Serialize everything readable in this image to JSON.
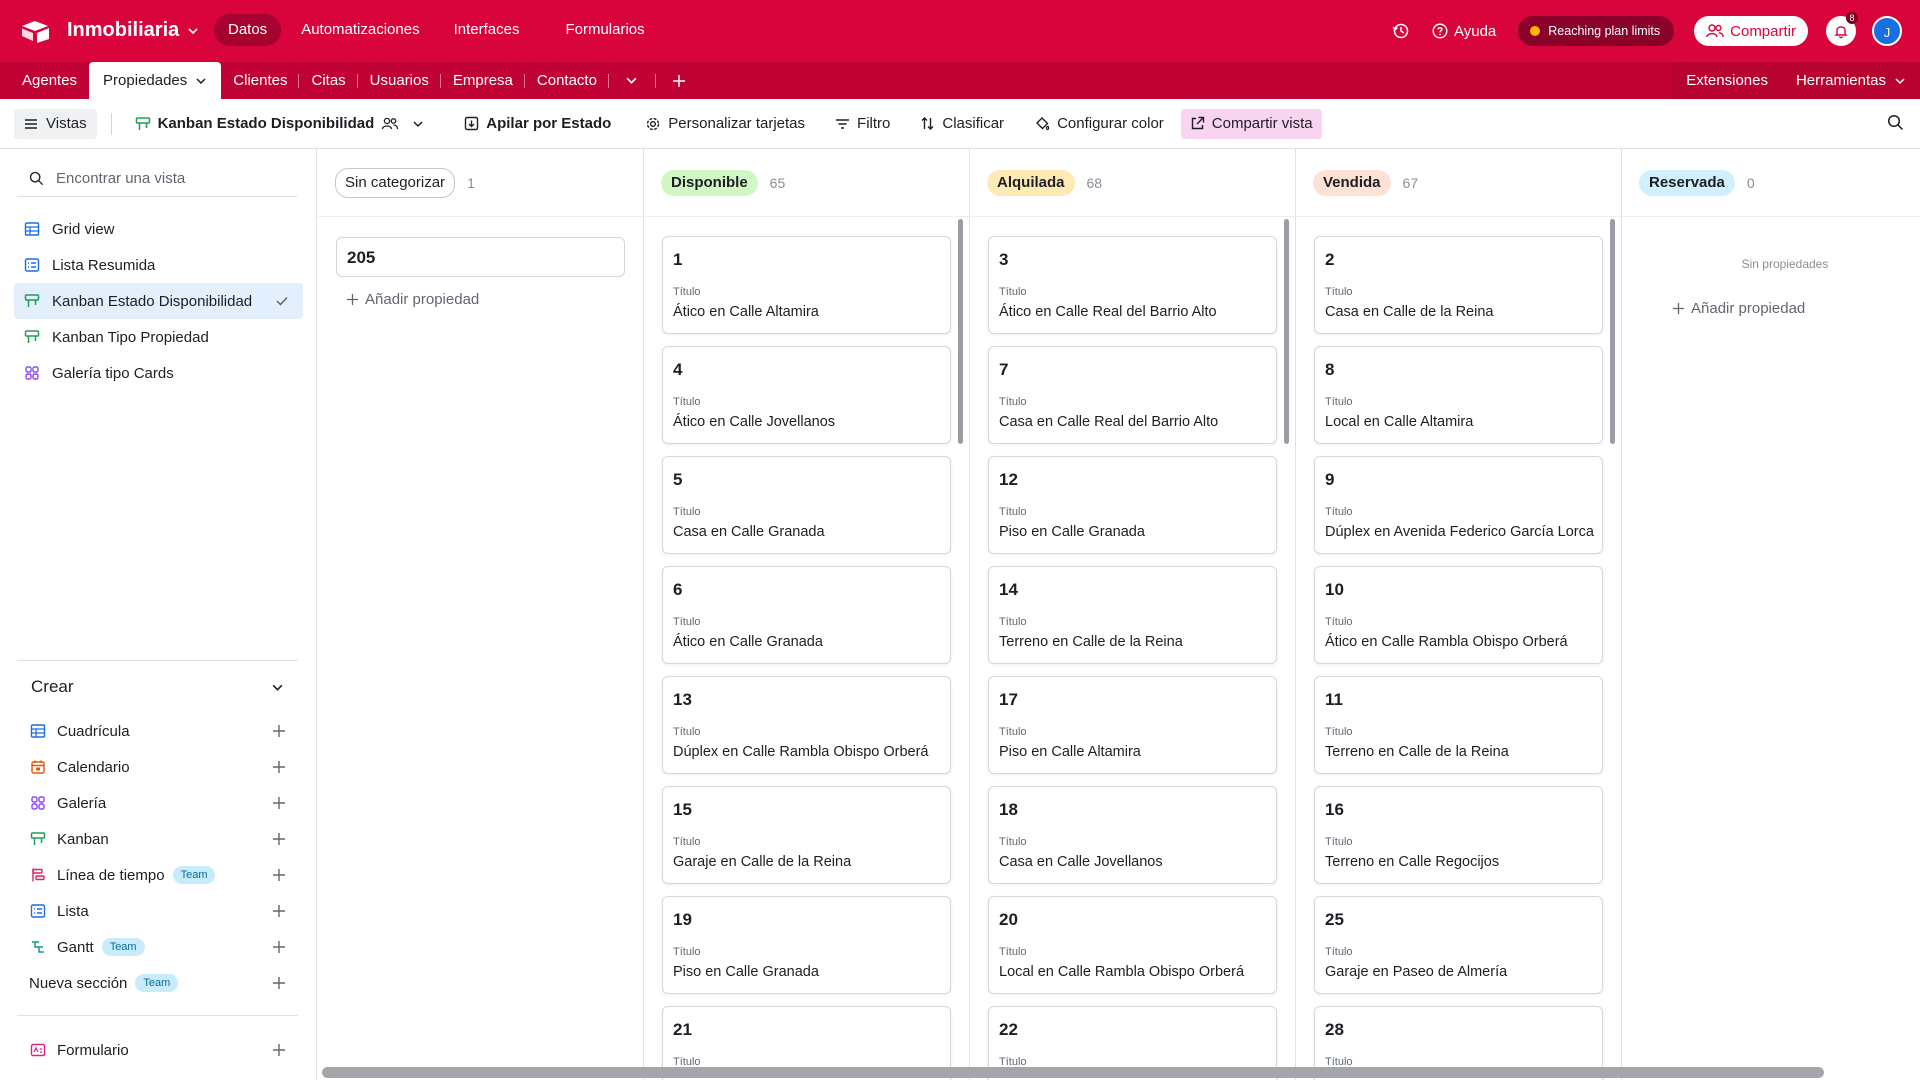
{
  "app": {
    "base_name": "Inmobiliaria"
  },
  "topnav": [
    "Datos",
    "Automatizaciones",
    "Interfaces",
    "Formularios"
  ],
  "topright": {
    "help": "Ayuda",
    "plan": "Reaching plan limits",
    "share": "Compartir",
    "notifications": "8",
    "avatar": "J"
  },
  "tables": [
    "Agentes",
    "Propiedades",
    "Clientes",
    "Citas",
    "Usuarios",
    "Empresa",
    "Contacto"
  ],
  "tables_right": [
    "Extensiones",
    "Herramientas"
  ],
  "viewbar": {
    "views": "Vistas",
    "current_view": "Kanban Estado Disponibilidad",
    "stack": "Apilar por Estado",
    "customize": "Personalizar tarjetas",
    "filter": "Filtro",
    "sort": "Clasificar",
    "color": "Configurar color",
    "share_view": "Compartir vista"
  },
  "sidebar": {
    "search_placeholder": "Encontrar una vista",
    "views": [
      "Grid view",
      "Lista Resumida",
      "Kanban Estado Disponibilidad",
      "Kanban Tipo Propiedad",
      "Galería tipo Cards"
    ],
    "create_title": "Crear",
    "create": [
      "Cuadrícula",
      "Calendario",
      "Galería",
      "Kanban",
      "Línea de tiempo",
      "Lista",
      "Gantt",
      "Nueva sección"
    ],
    "team_badge": "Team",
    "form": "Formulario"
  },
  "board": {
    "field_label": "Título",
    "add_property": "Añadir propiedad",
    "empty": "Sin propiedades",
    "uncategorized": {
      "name": "Sin categorizar",
      "count": "1",
      "card": "205"
    },
    "columns": [
      {
        "name": "Disponible",
        "count": "65",
        "color": "#d1f7c4",
        "cards": [
          {
            "id": "1",
            "title": "Ático en Calle Altamira"
          },
          {
            "id": "4",
            "title": "Ático en Calle Jovellanos"
          },
          {
            "id": "5",
            "title": "Casa en Calle Granada"
          },
          {
            "id": "6",
            "title": "Ático en Calle Granada"
          },
          {
            "id": "13",
            "title": "Dúplex en Calle Rambla Obispo Orberá"
          },
          {
            "id": "15",
            "title": "Garaje en Calle de la Reina"
          },
          {
            "id": "19",
            "title": "Piso en Calle Granada"
          },
          {
            "id": "21",
            "title": ""
          }
        ]
      },
      {
        "name": "Alquilada",
        "count": "68",
        "color": "#ffeab6",
        "cards": [
          {
            "id": "3",
            "title": "Ático en Calle Real del Barrio Alto"
          },
          {
            "id": "7",
            "title": "Casa en Calle Real del Barrio Alto"
          },
          {
            "id": "12",
            "title": "Piso en Calle Granada"
          },
          {
            "id": "14",
            "title": "Terreno en Calle de la Reina"
          },
          {
            "id": "17",
            "title": "Piso en Calle Altamira"
          },
          {
            "id": "18",
            "title": "Casa en Calle Jovellanos"
          },
          {
            "id": "20",
            "title": "Local en Calle Rambla Obispo Orberá"
          },
          {
            "id": "22",
            "title": ""
          }
        ]
      },
      {
        "name": "Vendida",
        "count": "67",
        "color": "#fee2d5",
        "cards": [
          {
            "id": "2",
            "title": "Casa en Calle de la Reina"
          },
          {
            "id": "8",
            "title": "Local en Calle Altamira"
          },
          {
            "id": "9",
            "title": "Dúplex en Avenida Federico García Lorca"
          },
          {
            "id": "10",
            "title": "Ático en Calle Rambla Obispo Orberá"
          },
          {
            "id": "11",
            "title": "Terreno en Calle de la Reina"
          },
          {
            "id": "16",
            "title": "Terreno en Calle Regocijos"
          },
          {
            "id": "25",
            "title": "Garaje en Paseo de Almería"
          },
          {
            "id": "28",
            "title": ""
          }
        ]
      },
      {
        "name": "Reservada",
        "count": "0",
        "color": "#d0f0fd",
        "cards": []
      }
    ]
  },
  "colors": {
    "brand": "#d9043b",
    "tablebar": "#c00334",
    "active_view": "#e3effd"
  }
}
